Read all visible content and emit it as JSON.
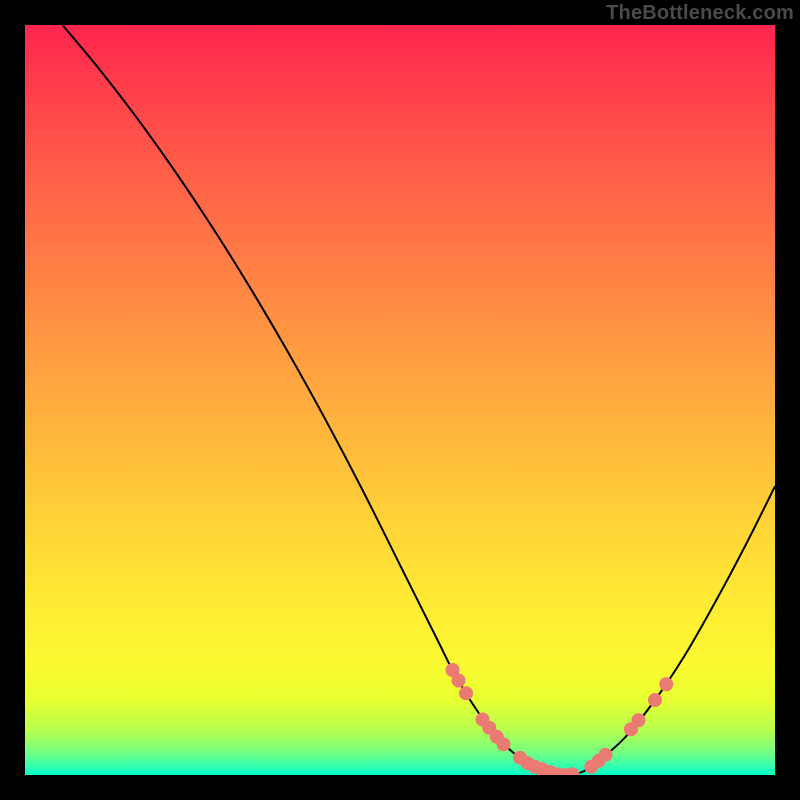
{
  "watermark": "TheBottleneck.com",
  "colors": {
    "dot_fill": "#eb7b72",
    "curve_stroke": "#000000"
  },
  "chart_data": {
    "type": "line",
    "title": "",
    "xlabel": "",
    "ylabel": "",
    "xlim": [
      0,
      100
    ],
    "ylim": [
      0,
      100
    ],
    "grid": false,
    "legend": false,
    "series": [
      {
        "name": "curve",
        "x": [
          5,
          10,
          15,
          20,
          25,
          30,
          35,
          40,
          45,
          50,
          55,
          57,
          60,
          63,
          66,
          69,
          72,
          74,
          76,
          80,
          84,
          88,
          92,
          96,
          100
        ],
        "y": [
          100,
          94,
          87.5,
          80.5,
          73,
          65,
          56.5,
          47.5,
          38,
          28,
          18,
          14,
          9,
          5,
          2.3,
          0.8,
          0,
          0.3,
          1.5,
          5,
          10,
          16,
          23,
          30.5,
          38.5
        ]
      }
    ],
    "points": [
      {
        "name": "cluster-left-upper",
        "x": 57.0,
        "y": 14.0
      },
      {
        "name": "cluster-left-upper",
        "x": 57.8,
        "y": 12.6
      },
      {
        "name": "cluster-left-upper",
        "x": 58.8,
        "y": 10.9
      },
      {
        "name": "cluster-left-mid",
        "x": 61.0,
        "y": 7.4
      },
      {
        "name": "cluster-left-mid",
        "x": 61.9,
        "y": 6.3
      },
      {
        "name": "cluster-left-mid",
        "x": 62.9,
        "y": 5.1
      },
      {
        "name": "cluster-left-mid",
        "x": 63.8,
        "y": 4.1
      },
      {
        "name": "trough-left",
        "x": 66.0,
        "y": 2.3
      },
      {
        "name": "trough-left",
        "x": 67.0,
        "y": 1.6
      },
      {
        "name": "trough-left",
        "x": 68.0,
        "y": 1.1
      },
      {
        "name": "trough-left",
        "x": 68.9,
        "y": 0.8
      },
      {
        "name": "trough-bottom",
        "x": 70.0,
        "y": 0.4
      },
      {
        "name": "trough-bottom",
        "x": 71.0,
        "y": 0.1
      },
      {
        "name": "trough-bottom",
        "x": 72.0,
        "y": 0.0
      },
      {
        "name": "trough-bottom",
        "x": 73.0,
        "y": 0.1
      },
      {
        "name": "trough-right",
        "x": 75.5,
        "y": 1.1
      },
      {
        "name": "trough-right",
        "x": 76.5,
        "y": 1.9
      },
      {
        "name": "trough-right",
        "x": 77.4,
        "y": 2.7
      },
      {
        "name": "cluster-right",
        "x": 80.8,
        "y": 6.1
      },
      {
        "name": "cluster-right",
        "x": 81.8,
        "y": 7.3
      },
      {
        "name": "cluster-right-upper",
        "x": 84.0,
        "y": 10.0
      },
      {
        "name": "cluster-right-upper",
        "x": 85.5,
        "y": 12.1
      }
    ]
  }
}
